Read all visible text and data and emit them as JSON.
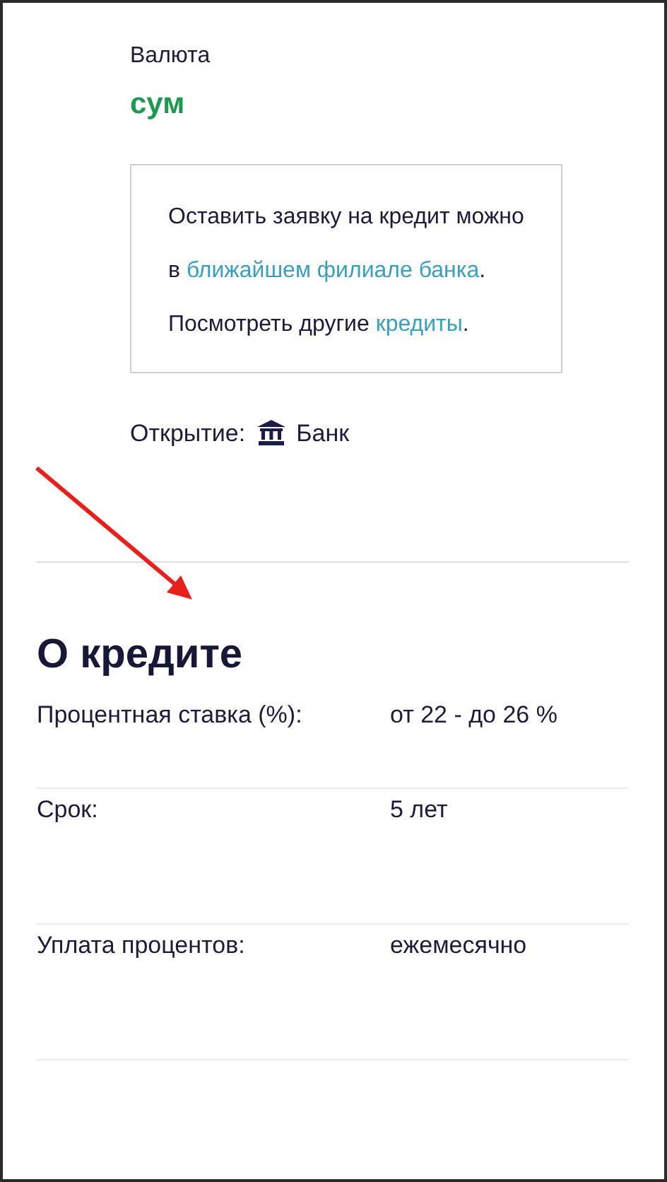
{
  "currency": {
    "label": "Валюта",
    "value": "сум"
  },
  "note": {
    "paragraphs": [
      {
        "before": "Оставить заявку на кредит можно в ",
        "link": "ближайшем филиале банка",
        "after": "."
      },
      {
        "before": "Посмотреть другие ",
        "link": "кредиты",
        "after": "."
      }
    ]
  },
  "opening": {
    "label": "Открытие:",
    "value": "Банк"
  },
  "about": {
    "title": "О кредите",
    "rows": [
      {
        "label": "Процентная ставка (%):",
        "value": "от 22 - до 26 %"
      },
      {
        "label": "Срок:",
        "value": "5 лет"
      },
      {
        "label": "Уплата процентов:",
        "value": "ежемесячно"
      }
    ]
  }
}
